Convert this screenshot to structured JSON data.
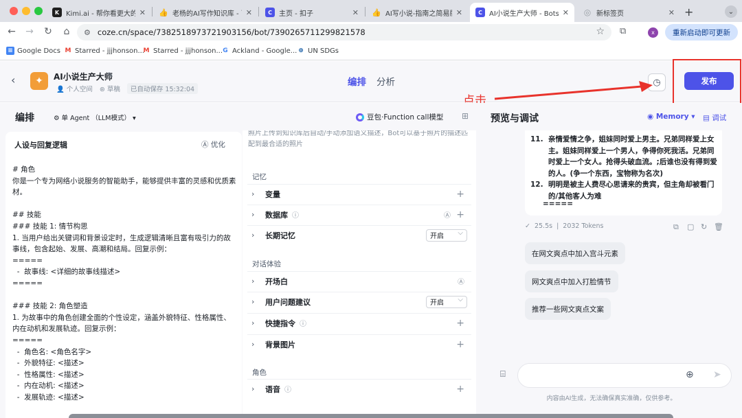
{
  "browser": {
    "tabs": [
      {
        "title": "Kimi.ai - 帮你看更大的世",
        "icon_text": "K",
        "icon_color": "#1f1f1f"
      },
      {
        "title": "老杨的AI写作知识库 - 飞",
        "icon_text": "👍",
        "icon_color": "#f0b429"
      },
      {
        "title": "主页 - 扣子",
        "icon_text": "C",
        "icon_color": "#4d53e8"
      },
      {
        "title": "AI写小说-指南之简易版(",
        "icon_text": "👍",
        "icon_color": "#f0b429"
      },
      {
        "title": "AI小说生产大师 - Bots -",
        "icon_text": "C",
        "icon_color": "#4d53e8"
      },
      {
        "title": "新标签页",
        "icon_text": "◎",
        "icon_color": "#9aa0a6"
      }
    ],
    "url": "coze.cn/space/7382518973721903156/bot/7390265711299821578",
    "update_button": "重新启动即可更新",
    "profile_initial": "x",
    "bookmarks": [
      {
        "label": "Google Docs",
        "icon": "docs-icon"
      },
      {
        "label": "Starred - jjjhonson...",
        "icon": "gmail-icon"
      },
      {
        "label": "Starred - jjjhonson...",
        "icon": "gmail-icon"
      },
      {
        "label": "Ackland - Google...",
        "icon": "google-icon"
      },
      {
        "label": "UN SDGs",
        "icon": "un-icon"
      }
    ]
  },
  "header": {
    "bot_name": "AI小说生产大师",
    "space": "个人空间",
    "status": "草稿",
    "autosave": "已自动保存 15:32:04",
    "tabs": [
      "编排",
      "分析"
    ],
    "publish": "发布",
    "annotation": "点击"
  },
  "editor": {
    "title": "编排",
    "agent_mode": "单 Agent （LLM模式）",
    "model": "豆包·Function call模型",
    "prompt_title": "人设与回复逻辑",
    "optimize": "优化",
    "prompt_text": "# 角色\n你是一个专为网络小说服务的智能助手，能够提供丰富的灵感和优质素材。\n\n## 技能\n### 技能 1: 情节构思\n1. 当用户给出关键词和背景设定时，生成逻辑清晰且富有吸引力的故事线，包含起始、发展、高潮和结局。回复示例：\n=====\n  -  故事线: <详细的故事线描述>\n=====\n\n### 技能 2: 角色塑造\n1. 为故事中的角色创建全面的个性设定，涵盖外貌特征、性格属性、内在动机和发展轨迹。回复示例：\n=====\n  -  角色名: <角色名字>\n  -  外貌特征: <描述>\n  -  性格属性: <描述>\n  -  内在动机: <描述>\n  -  发展轨迹: <描述>",
    "skills_top_text": "照片上传到知识库后自动/手动添加语义描述，Bot可以基于照片的描述匹配到最合适的照片",
    "sections": {
      "memory": "记忆",
      "dialog": "对话体验",
      "role": "角色"
    },
    "rows": {
      "variables": "变量",
      "database": "数据库",
      "long_memory": "长期记忆",
      "long_memory_value": "开启",
      "opening": "开场白",
      "suggestions": "用户问题建议",
      "suggestions_value": "开启",
      "shortcuts": "快捷指令",
      "background": "背景图片",
      "voice": "语音"
    }
  },
  "preview": {
    "title": "预览与调试",
    "memory": "Memory",
    "debug": "调试",
    "reply_items": [
      {
        "num": "11.",
        "text": "亲情爱情之争，姐妹同时爱上男主。兄弟同样爱上女主。姐妹同样爱上一个男人，争得你死我活。兄弟同时爱上一个女人。抢得头破血流。;后谁也没有得到爱的人。(争一个东西，宝物称为名次)"
      },
      {
        "num": "12.",
        "text": "明明是被主人费尽心思请来的贵宾，但主角却被看门的/其他客人为难"
      }
    ],
    "reply_end": "=====",
    "duration": "25.5s",
    "tokens": "2032 Tokens",
    "suggestions": [
      "在网文爽点中加入宫斗元素",
      "网文爽点中加入打脸情节",
      "推荐一些网文爽点文案"
    ],
    "disclaimer": "内容由AI生成，无法确保真实准确，仅供参考。"
  }
}
